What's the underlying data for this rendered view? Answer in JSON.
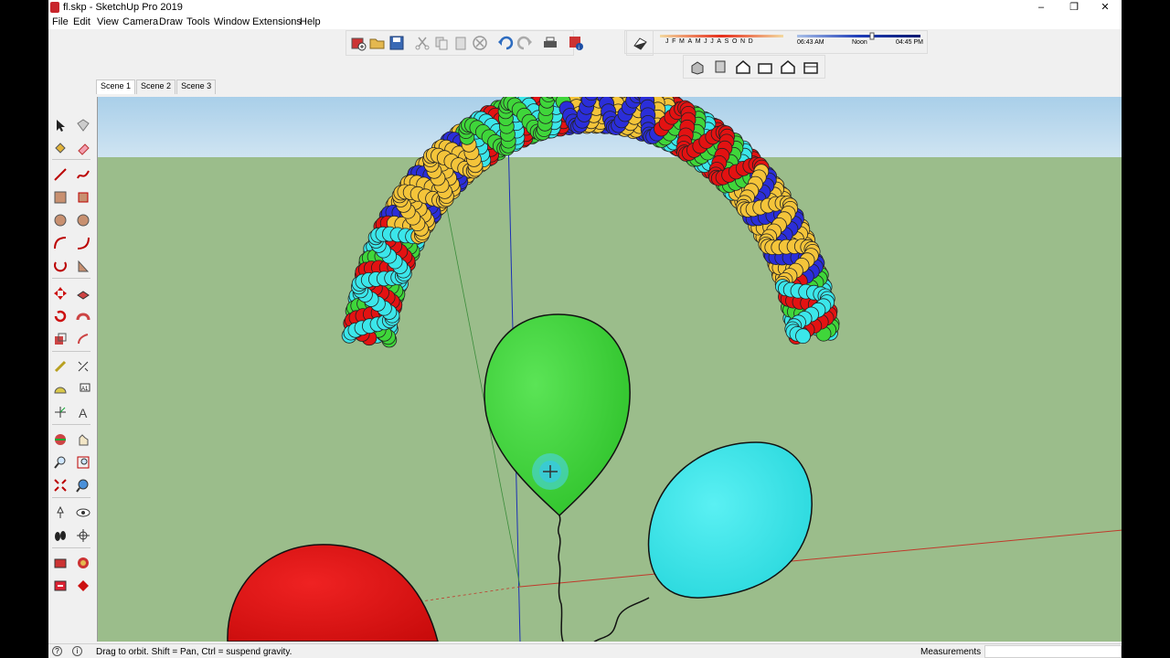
{
  "window": {
    "title": "fl.skp - SketchUp Pro 2019",
    "minimize_glyph": "–",
    "restore_glyph": "❐",
    "close_glyph": "✕"
  },
  "menu": [
    "File",
    "Edit",
    "View",
    "Camera",
    "Draw",
    "Tools",
    "Window",
    "Extensions",
    "Help"
  ],
  "shadow_settings": {
    "months": [
      "J",
      "F",
      "M",
      "A",
      "M",
      "J",
      "J",
      "A",
      "S",
      "O",
      "N",
      "D"
    ],
    "time_start": "06:43 AM",
    "time_mid": "Noon",
    "time_end": "04:45 PM"
  },
  "scenes": [
    "Scene 1",
    "Scene 2",
    "Scene 3"
  ],
  "active_scene": "Scene 1",
  "status": {
    "message": "Drag to orbit. Shift = Pan, Ctrl = suspend gravity.",
    "measurements_label": "Measurements",
    "measurements_value": ""
  },
  "toolbar_icons": [
    "new-model-icon",
    "open-icon",
    "save-icon",
    "cut-icon",
    "copy-icon",
    "paste-icon",
    "erase-icon",
    "undo-icon",
    "redo-icon",
    "print-icon",
    "model-info-icon",
    "shadows-toggle-icon"
  ],
  "view_icons": [
    "iso-view-icon",
    "top-view-icon",
    "front-view-icon",
    "right-view-icon",
    "back-view-icon",
    "left-view-icon"
  ],
  "colors": {
    "sky": "#b7d9ef",
    "ground": "#9bbd8b",
    "red_balloon": "#e31212",
    "green_balloon": "#3fd63a",
    "cyan_balloon": "#3be6ea",
    "yellow_bead": "#f4c43a",
    "blue_bead": "#2b2ed9"
  }
}
